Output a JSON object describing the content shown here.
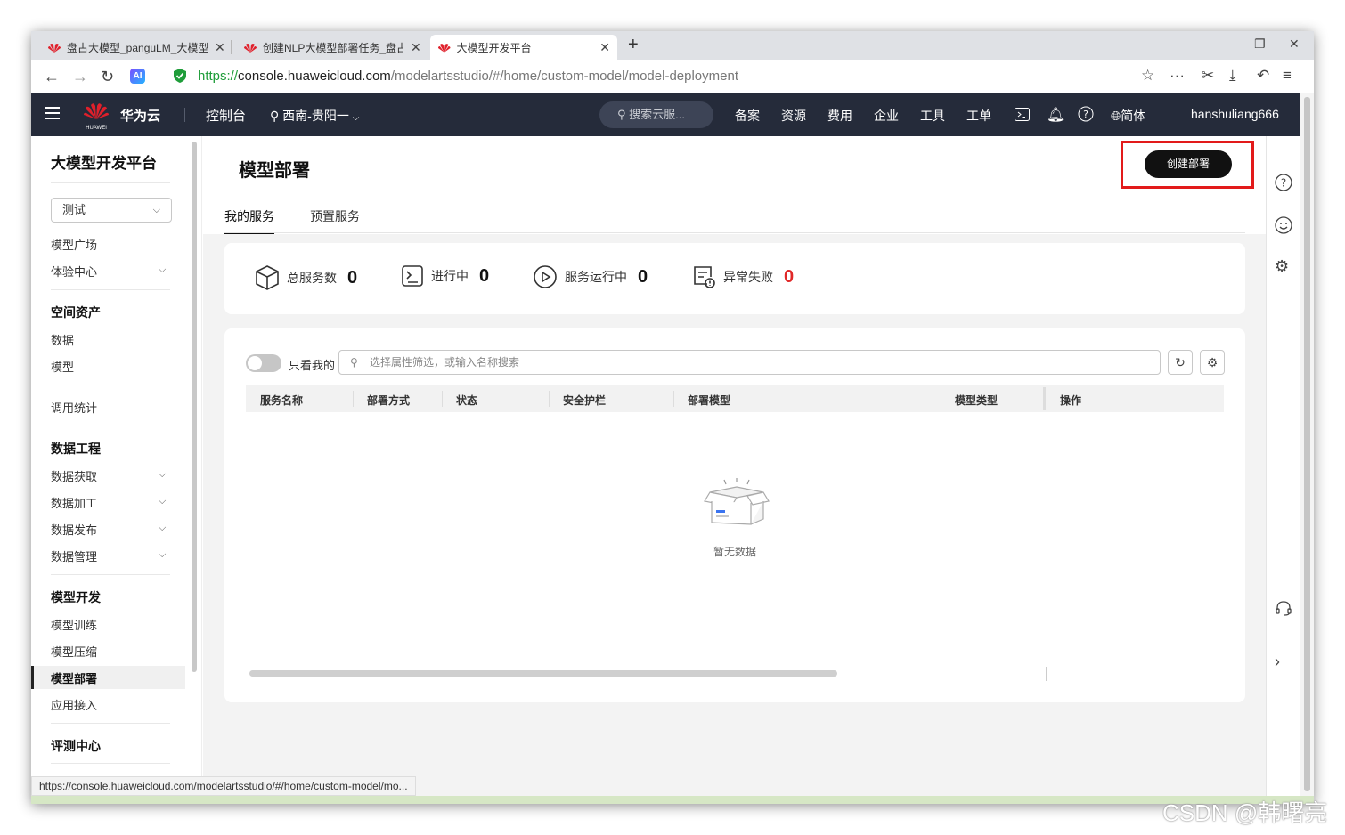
{
  "browser": {
    "tabs": [
      {
        "title": "盘古大模型_panguLM_大模型",
        "active": false
      },
      {
        "title": "创建NLP大模型部署任务_盘古",
        "active": false
      },
      {
        "title": "大模型开发平台",
        "active": true
      }
    ],
    "url": {
      "protocol": "https://",
      "host": "console.huaweicloud.com",
      "path": "/modelartsstudio/#/home/custom-model/model-deployment"
    },
    "status_url": "https://console.huaweicloud.com/modelartsstudio/#/home/custom-model/mo..."
  },
  "header": {
    "logo_text": "HUAWEI",
    "brand": "华为云",
    "console": "控制台",
    "region": "西南-贵阳一",
    "search_placeholder": "搜索云服...",
    "nav": [
      "备案",
      "资源",
      "费用",
      "企业",
      "工具",
      "工单"
    ],
    "language": "简体",
    "username": "hanshuliang666"
  },
  "sidebar": {
    "title": "大模型开发平台",
    "workspace": "测试",
    "items": {
      "model_plaza": "模型广场",
      "experience": "体验中心",
      "space_assets": "空间资产",
      "data": "数据",
      "model": "模型",
      "call_stats": "调用统计",
      "data_engineering": "数据工程",
      "data_acquire": "数据获取",
      "data_process": "数据加工",
      "data_publish": "数据发布",
      "data_manage": "数据管理",
      "model_dev": "模型开发",
      "model_train": "模型训练",
      "model_compress": "模型压缩",
      "model_deploy": "模型部署",
      "app_access": "应用接入",
      "eval_center": "评测中心"
    }
  },
  "main": {
    "title": "模型部署",
    "create_button": "创建部署",
    "tabs": [
      "我的服务",
      "预置服务"
    ],
    "stats": [
      {
        "label": "总服务数",
        "value": "0"
      },
      {
        "label": "进行中",
        "value": "0"
      },
      {
        "label": "服务运行中",
        "value": "0"
      },
      {
        "label": "异常失败",
        "value": "0"
      }
    ],
    "only_mine": "只看我的",
    "filter_placeholder": "选择属性筛选，或输入名称搜索",
    "columns": [
      "服务名称",
      "部署方式",
      "状态",
      "安全护栏",
      "部署模型",
      "模型类型",
      "操作"
    ],
    "empty_text": "暂无数据"
  },
  "watermark": "CSDN @韩曙亮",
  "colors": {
    "header_bg": "#252b3a",
    "primary_button": "#111111",
    "error": "#e02828",
    "highlight_box": "#e21a1a",
    "secure_url": "#1f9d3a"
  }
}
